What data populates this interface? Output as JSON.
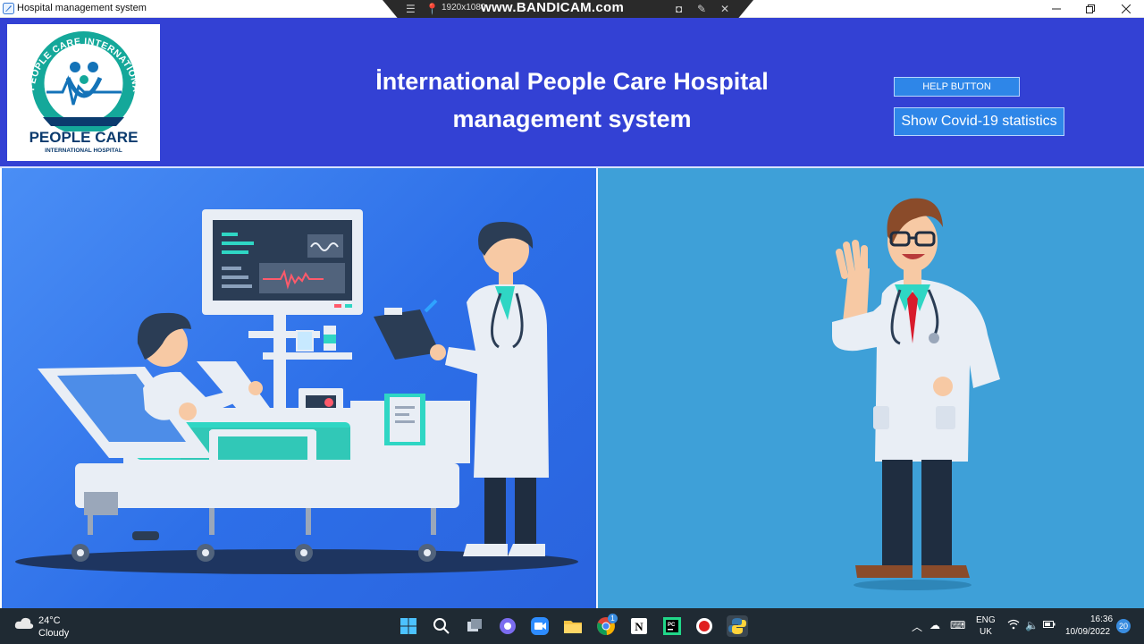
{
  "window": {
    "title": "Hospital management system"
  },
  "recorder": {
    "resolution": "1920x1080",
    "brand": "www.BANDICAM.com"
  },
  "header": {
    "logo_name": "PEOPLE CARE",
    "logo_subtitle": "INTERNATIONAL HOSPITAL",
    "logo_ring_text": "PEOPLE CARE INTERNATIONAL HOSPITAL",
    "title_line1": "İnternational People Care Hospital",
    "title_line2": "management system",
    "help_button": "HELP BUTTON",
    "covid_button": "Show Covid-19 statistics"
  },
  "colors": {
    "header_bg": "#3341d4",
    "button_bg": "#2e86e8",
    "left_panel_bg": "#2d6fe8",
    "right_panel_bg": "#3ea0d8",
    "logo_teal": "#14a89a",
    "taskbar_bg": "#1f2a33"
  },
  "illustrations": {
    "left": "doctor-with-patient-in-hospital-bed",
    "right": "doctor-waving"
  },
  "taskbar": {
    "weather_temp": "24°C",
    "weather_desc": "Cloudy",
    "language_top": "ENG",
    "language_bottom": "UK",
    "time": "16:36",
    "date": "10/09/2022",
    "notification_count": "20",
    "chrome_badge": "1",
    "apps": [
      "windows-start-icon",
      "search-icon",
      "task-view-icon",
      "chat-icon",
      "zoom-icon",
      "file-explorer-icon",
      "chrome-icon",
      "notion-icon",
      "pycharm-icon",
      "record-icon",
      "python-icon"
    ]
  }
}
